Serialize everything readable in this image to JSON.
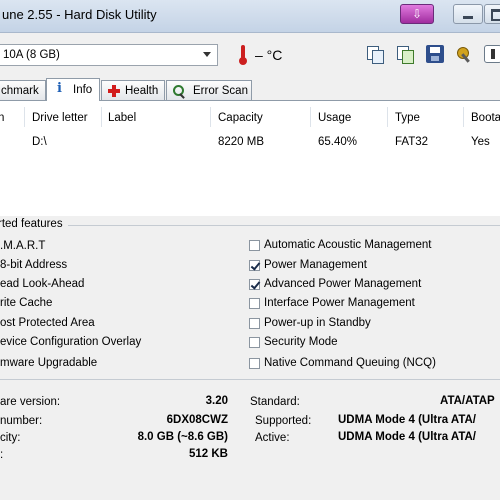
{
  "window": {
    "title": "une 2.55 - Hard Disk Utility",
    "button_glyph": "⇩"
  },
  "toolbar": {
    "drive_select_value": "10A (8 GB)",
    "temperature": "– °C"
  },
  "tabs": [
    {
      "label": "chmark"
    },
    {
      "label": "Info"
    },
    {
      "label": "Health"
    },
    {
      "label": "Error Scan"
    }
  ],
  "partitions": {
    "columns": [
      "n",
      "Drive letter",
      "Label",
      "Capacity",
      "Usage",
      "Type",
      "Boota"
    ],
    "rows": [
      {
        "drive_letter": "D:\\",
        "label": "",
        "capacity": "8220 MB",
        "usage": "65.40%",
        "type": "FAT32",
        "bootable": "Yes"
      }
    ]
  },
  "features": {
    "group_title": "rted features",
    "left": [
      {
        "label": ".M.A.R.T"
      },
      {
        "label": "8-bit Address"
      },
      {
        "label": "ead Look-Ahead"
      },
      {
        "label": "rite Cache"
      },
      {
        "label": "ost Protected Area"
      },
      {
        "label": "evice Configuration Overlay"
      },
      {
        "label": "mware Upgradable"
      }
    ],
    "right": [
      {
        "label": "Automatic Acoustic Management",
        "checked": false
      },
      {
        "label": "Power Management",
        "checked": true
      },
      {
        "label": "Advanced Power Management",
        "checked": true
      },
      {
        "label": "Interface Power Management",
        "checked": false
      },
      {
        "label": "Power-up in Standby",
        "checked": false
      },
      {
        "label": "Security Mode",
        "checked": false
      },
      {
        "label": "Native Command Queuing (NCQ)",
        "checked": false
      }
    ]
  },
  "details": {
    "left": [
      {
        "label": "are version:",
        "value": "3.20"
      },
      {
        "label": "number:",
        "value": "6DX08CWZ"
      },
      {
        "label": "city:",
        "value": "8.0 GB (~8.6 GB)"
      },
      {
        "label": ":",
        "value": "512 KB"
      }
    ],
    "right": [
      {
        "label": "Standard:",
        "value": "ATA/ATAP"
      },
      {
        "label": "Supported:",
        "value": "UDMA Mode 4 (Ultra ATA/"
      },
      {
        "label": "Active:",
        "value": "UDMA Mode 4 (Ultra ATA/"
      }
    ]
  }
}
